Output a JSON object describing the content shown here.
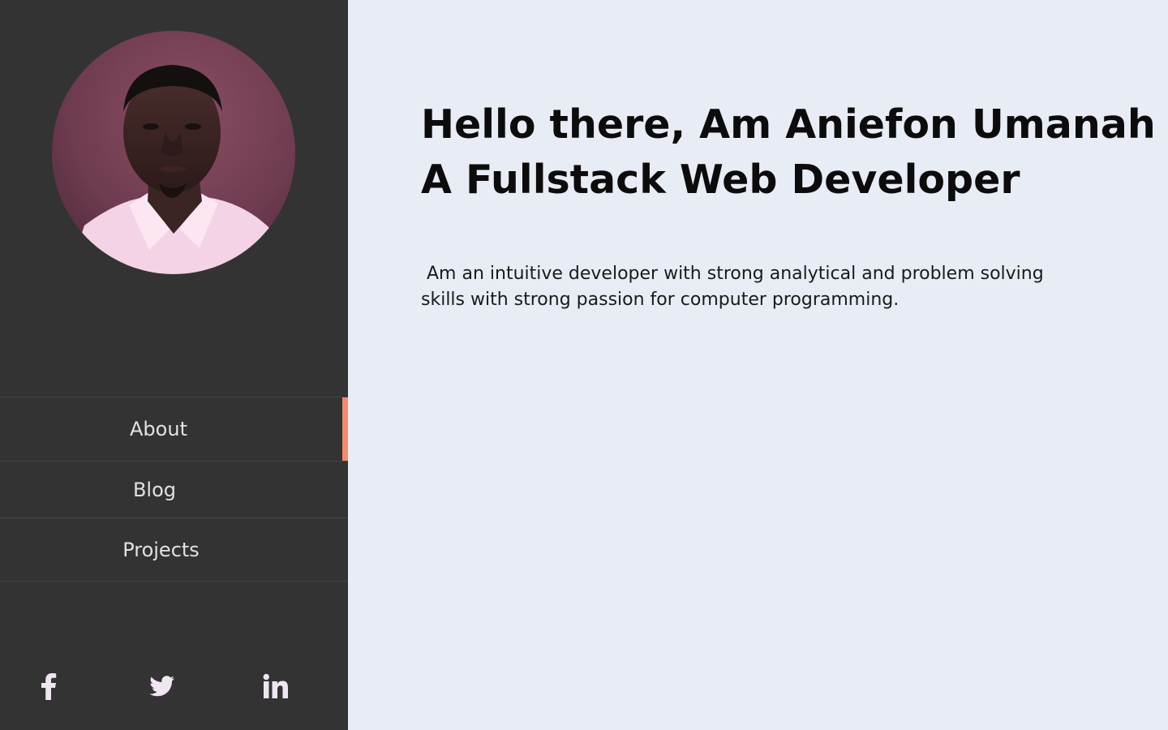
{
  "sidebar": {
    "avatar": {
      "icon": "profile-photo"
    },
    "nav": [
      {
        "label": "About",
        "active": true
      },
      {
        "label": "Blog",
        "active": false
      },
      {
        "label": "Projects",
        "active": false
      }
    ],
    "social": [
      {
        "icon": "facebook-icon"
      },
      {
        "icon": "twitter-icon"
      },
      {
        "icon": "linkedin-icon"
      }
    ]
  },
  "main": {
    "headline_line1": "Hello there, Am Aniefon Umanah",
    "headline_line2": "A Fullstack Web Developer",
    "bio": " Am an intuitive developer with strong analytical and problem solving skills with strong passion for computer programming."
  },
  "colors": {
    "sidebar_bg": "#333333",
    "page_bg": "#e8ecf5",
    "accent": "#f08b6e",
    "nav_text": "#e2e2e2",
    "icon_color": "#efe6f2"
  }
}
